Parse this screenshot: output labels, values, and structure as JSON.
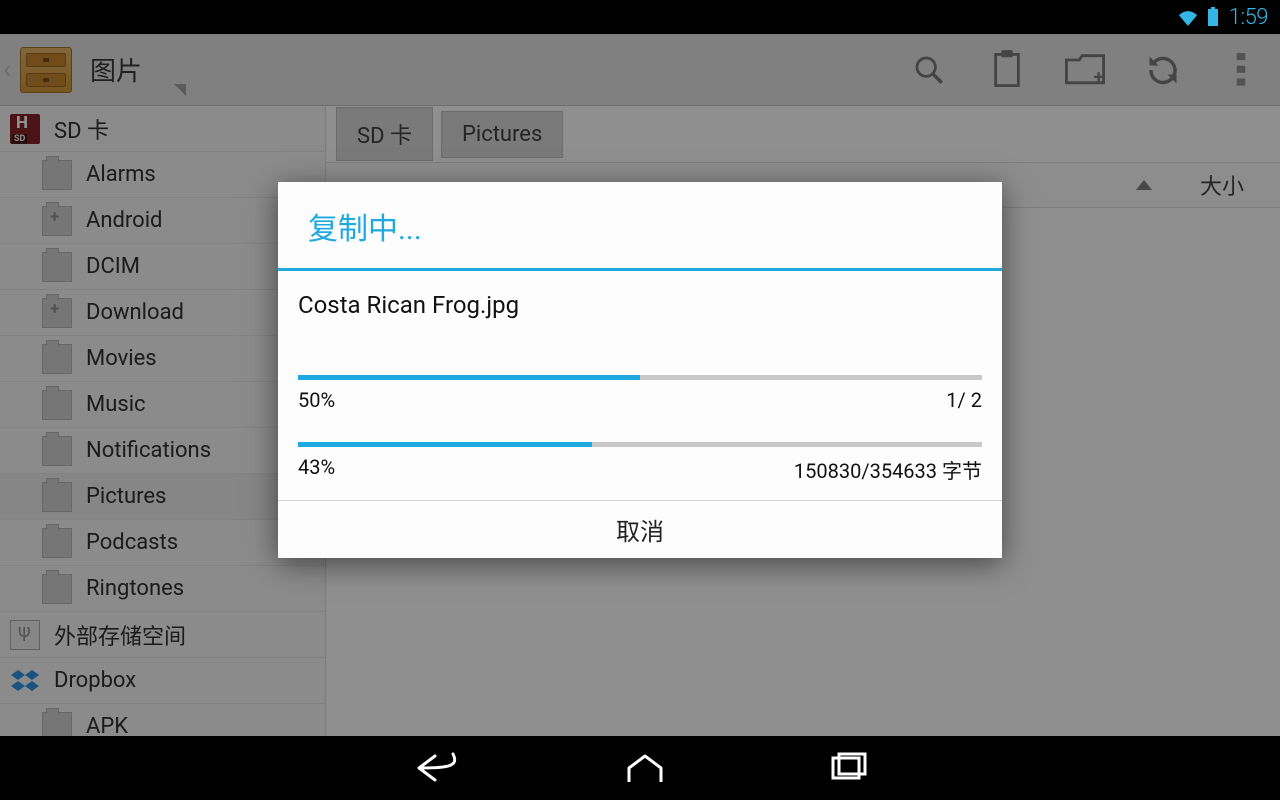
{
  "status": {
    "time": "1:59"
  },
  "actionbar": {
    "title": "图片"
  },
  "sidebar": {
    "items": [
      {
        "label": "SD 卡",
        "icon": "sd",
        "indent": false
      },
      {
        "label": "Alarms",
        "icon": "folder",
        "indent": true
      },
      {
        "label": "Android",
        "icon": "folder-plus",
        "indent": true
      },
      {
        "label": "DCIM",
        "icon": "folder",
        "indent": true
      },
      {
        "label": "Download",
        "icon": "folder-plus",
        "indent": true
      },
      {
        "label": "Movies",
        "icon": "folder",
        "indent": true
      },
      {
        "label": "Music",
        "icon": "folder",
        "indent": true
      },
      {
        "label": "Notifications",
        "icon": "folder",
        "indent": true
      },
      {
        "label": "Pictures",
        "icon": "folder",
        "indent": true,
        "selected": true
      },
      {
        "label": "Podcasts",
        "icon": "folder",
        "indent": true
      },
      {
        "label": "Ringtones",
        "icon": "folder",
        "indent": true
      },
      {
        "label": "外部存储空间",
        "icon": "usb",
        "indent": false
      },
      {
        "label": "Dropbox",
        "icon": "dropbox",
        "indent": false
      },
      {
        "label": "APK",
        "icon": "folder",
        "indent": true
      }
    ]
  },
  "breadcrumbs": [
    "SD 卡",
    "Pictures"
  ],
  "list_header": {
    "size_label": "大小"
  },
  "dialog": {
    "title": "复制中...",
    "filename": "Costa Rican Frog.jpg",
    "overall": {
      "percent": 50,
      "text": "50%",
      "count": "1/ 2"
    },
    "current": {
      "percent": 43,
      "text": "43%",
      "bytes": "150830/354633 字节"
    },
    "cancel": "取消"
  },
  "colors": {
    "accent": "#1ea9e1"
  }
}
